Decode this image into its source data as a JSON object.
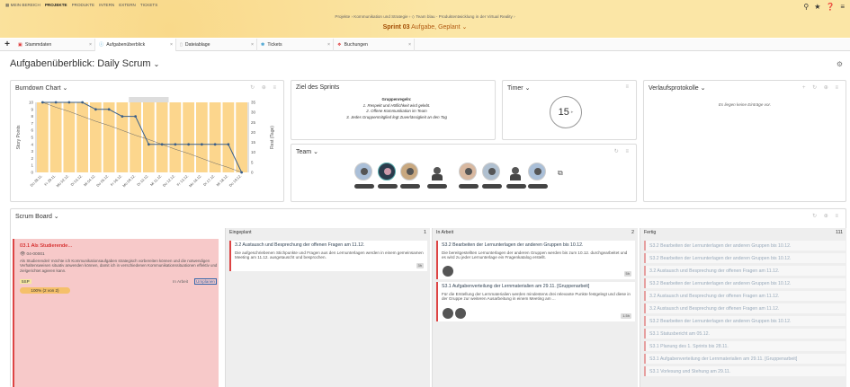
{
  "nav": {
    "items": [
      "MEIN BEREICH",
      "PROJEKTE",
      "PRODUKTE",
      "INTERN",
      "EXTERN",
      "TICKETS"
    ],
    "active": 1
  },
  "breadcrumb": "Projekte  ›  Kommunikation und Strategie  ›  ◇ Team blau - Produktentwicklung in der Virtual Reality  ›",
  "sprint": {
    "title": "Sprint 03",
    "subtitle": "Aufgabe, Geplant"
  },
  "tabs": [
    {
      "label": "Stammdaten",
      "icon": "red-square-icon"
    },
    {
      "label": "Aufgabenüberblick",
      "icon": "info-icon"
    },
    {
      "label": "Dateiablage",
      "icon": "file-icon"
    },
    {
      "label": "Tickets",
      "icon": "ticket-icon"
    },
    {
      "label": "Buchungen",
      "icon": "booking-icon"
    }
  ],
  "page_title": "Aufgabenüberblick: Daily Scrum",
  "burndown": {
    "title": "Burndown Chart"
  },
  "chart_data": {
    "type": "bar",
    "title": "Burndown Chart",
    "categories": [
      "Do 28.11.",
      "Fr 29.11.",
      "Mo 02.12.",
      "Di 03.12.",
      "Mi 04.12.",
      "Do 05.12.",
      "Fr 06.12.",
      "Mo 09.12.",
      "Di 10.12.",
      "Mi 11.12.",
      "Do 12.12.",
      "Fr 13.12.",
      "Mo 16.12.",
      "Di 17.12.",
      "Mi 18.12.",
      "Do 19.12."
    ],
    "ylabel": "Story Points",
    "y2label": "Rest (Tage)",
    "ylim": [
      0,
      10
    ],
    "y2lim": [
      0,
      35
    ],
    "yticks": [
      0,
      1,
      2,
      3,
      4,
      5,
      6,
      7,
      8,
      9,
      10
    ],
    "y2ticks": [
      0,
      5,
      10,
      15,
      20,
      25,
      30,
      35
    ],
    "series": [
      {
        "type": "bar",
        "values": [
          10,
          10,
          10,
          10,
          10,
          10,
          10,
          10,
          10,
          10,
          10,
          10,
          10,
          10,
          10,
          10
        ]
      },
      {
        "type": "line",
        "values": [
          10,
          10,
          10,
          10,
          9,
          9,
          8,
          8,
          4,
          4,
          4,
          4,
          4,
          4,
          4,
          0
        ]
      },
      {
        "type": "line",
        "values": [
          10,
          9.3,
          8.7,
          8,
          7.3,
          6.7,
          6,
          5.3,
          4.7,
          4,
          3.3,
          2.7,
          2,
          1.3,
          0.7,
          0
        ]
      }
    ],
    "grid": false
  },
  "goal": {
    "title": "Ziel des Sprints",
    "lines": [
      "Gruppenregeln:",
      "1.   Respekt und Höflichkeit wird gelebt.",
      "2.   Offene Kommunikation im Team",
      "3.   Jedes Gruppenmitglied legt Zuverlässigkeit an den Tag"
    ]
  },
  "timer": {
    "title": "Timer",
    "value": "15"
  },
  "history": {
    "title": "Verlaufsprotokolle",
    "empty": "Es liegen keine Einträge vor."
  },
  "team": {
    "title": "Team"
  },
  "scrum": {
    "title": "Scrum Board"
  },
  "story": {
    "title": "03.1 Als Studierende...",
    "id": "04-00001",
    "desc": "Als Studierende/r möchte ich Kommunikationsaufgaben strategisch vorbereiten können und die notwendigen Verhaltensweisen situativ anwenden können, damit ich in verschiedenen Kommunikationssituationen effektiv und zielgerichtet agieren kann.",
    "sp": "5SP",
    "status": "In Arbeit",
    "button": "Umplanen",
    "progress": "100% (2 von 2)"
  },
  "columns": [
    {
      "title": "Eingeplant",
      "count": "1"
    },
    {
      "title": "In Arbeit",
      "count": "2"
    },
    {
      "title": "Fertig",
      "count": "111"
    }
  ],
  "planned_cards": [
    {
      "title": "3.2 Austausch und Besprechung der offenen Fragen am 11.12.",
      "desc": "Die aufgeschriebenen Stichpunkte und Fragen aus den Lernunterlagen werden in einem gemeinsamen Meeting am 11.12. ausgetauscht und besprochen.",
      "hours": "3h"
    }
  ],
  "work_cards": [
    {
      "title": "S3.2 Bearbeiten der Lernunterlagen der anderen Gruppen bis 10.12.",
      "desc": "Die bereitgestellten Lernunterlagen der anderen Gruppen werden bis zum 10.12. durchgearbeitet und es wird zu jeder Lernunterlage ein Fragenkatalog erstellt.",
      "hours": "5h"
    },
    {
      "title": "S3.1 Aufgabenverteilung der Lernmaterialien am 29.11. [Gruppenarbeit]",
      "desc": "Für die Erstellung der Lernmaterialien werden mindestens drei relevante Punkte festgelegt und diese in der Gruppe zur weiteren Ausarbeitung in einem Meeting am ...",
      "hours": "1.5h"
    }
  ],
  "done_items": [
    "S3.2 Bearbeiten der Lernunterlagen der anderen Gruppen bis 10.12.",
    "S3.2 Bearbeiten der Lernunterlagen der anderen Gruppen bis 10.12.",
    "3.2 Austausch und Besprechung der offenen Fragen am 11.12.",
    "S3.2 Bearbeiten der Lernunterlagen der anderen Gruppen bis 10.12.",
    "3.2 Austausch und Besprechung der offenen Fragen am 11.12.",
    "3.2 Austausch und Besprechung der offenen Fragen am 11.12.",
    "S3.2 Bearbeiten der Lernunterlagen der anderen Gruppen bis 10.12.",
    "S3.1 Statusbericht am 05.12.",
    "S3.1 Planung des 1. Sprints bis 28.11.",
    "S3.1 Aufgabenverteilung der Lernmaterialien am 29.11. [Gruppenarbeit]",
    "S3.1 Vorlesung und Stehung am 29.11."
  ]
}
